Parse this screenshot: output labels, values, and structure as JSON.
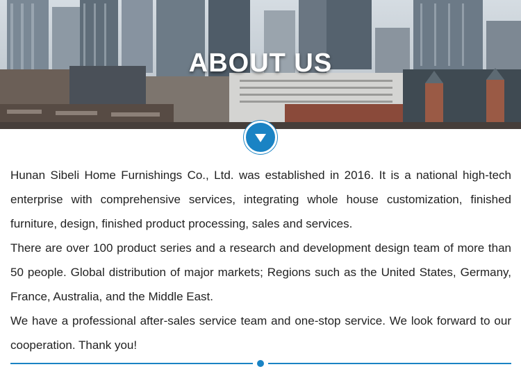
{
  "banner": {
    "title": "ABOUT US"
  },
  "nav": {
    "down_icon": "chevron-down-icon"
  },
  "content": {
    "paragraphs": [
      "Hunan Sibeli Home Furnishings Co., Ltd. was established in 2016. It is a national high-tech enterprise with comprehensive services, integrating whole house customization, finished furniture, design, finished product processing, sales and services.",
      "There are over 100 product series and a research and development design team of more than 50 people. Global distribution of major markets; Regions such as the United States, Germany, France, Australia, and the Middle East.",
      "We have a professional after-sales service team and one-stop service. We look forward to our cooperation. Thank you!"
    ]
  },
  "colors": {
    "accent": "#1a83c4",
    "text": "#222222",
    "background": "#ffffff"
  }
}
